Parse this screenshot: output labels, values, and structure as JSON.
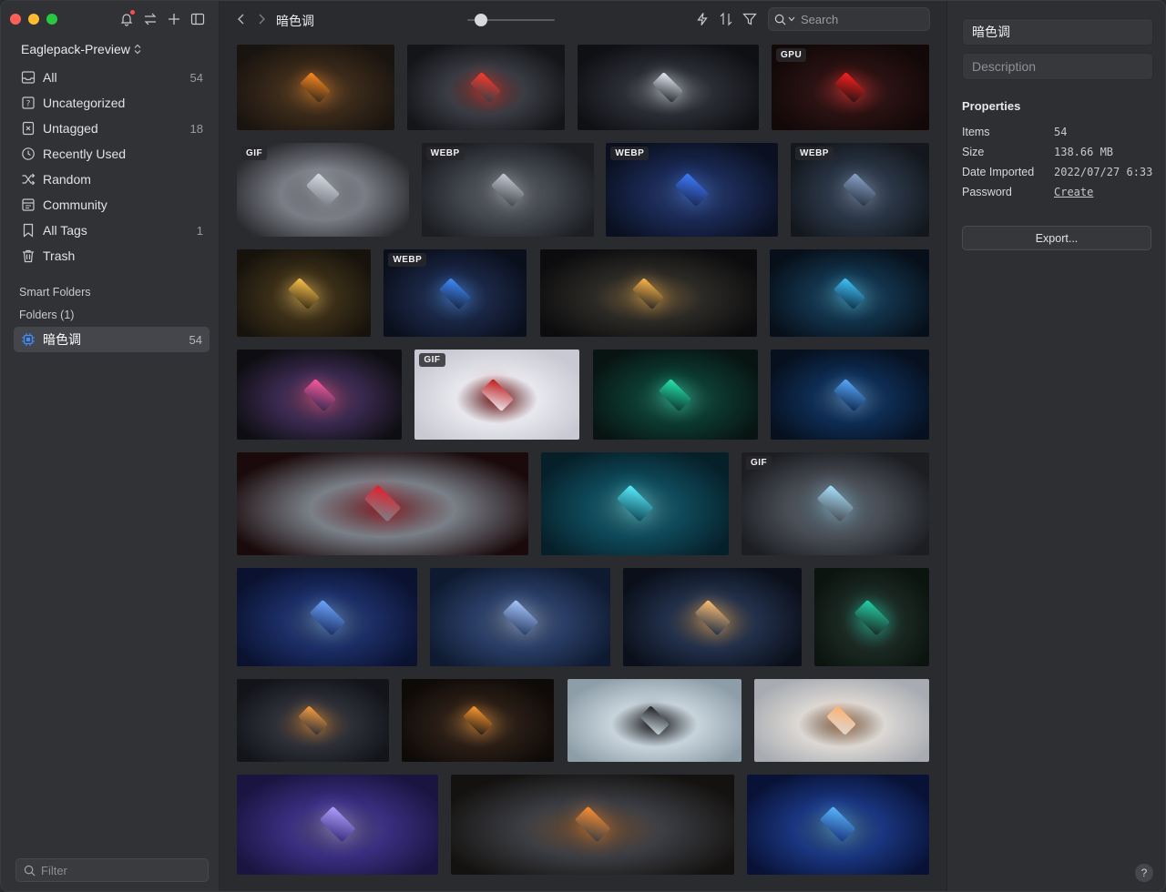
{
  "library": {
    "name": "Eaglepack-Preview"
  },
  "sidebar": {
    "items": [
      {
        "label": "All",
        "count": "54",
        "icon": "inbox-icon"
      },
      {
        "label": "Uncategorized",
        "count": "",
        "icon": "question-folder-icon"
      },
      {
        "label": "Untagged",
        "count": "18",
        "icon": "untagged-icon"
      },
      {
        "label": "Recently Used",
        "count": "",
        "icon": "clock-icon"
      },
      {
        "label": "Random",
        "count": "",
        "icon": "shuffle-icon"
      },
      {
        "label": "Community",
        "count": "",
        "icon": "community-icon"
      },
      {
        "label": "All Tags",
        "count": "1",
        "icon": "bookmark-icon"
      },
      {
        "label": "Trash",
        "count": "",
        "icon": "trash-icon"
      }
    ],
    "smart_folders_label": "Smart Folders",
    "folders_label": "Folders (1)",
    "folder": {
      "label": "暗色调",
      "count": "54"
    },
    "filter_placeholder": "Filter"
  },
  "toolbar": {
    "folder_title": "暗色调",
    "search_placeholder": "Search",
    "zoom_level": 0.1
  },
  "grid": {
    "rows": [
      [
        {
          "badge": ""
        },
        {
          "badge": ""
        },
        {
          "badge": ""
        },
        {
          "badge": "GPU"
        }
      ],
      [
        {
          "badge": "GIF"
        },
        {
          "badge": "WEBP"
        },
        {
          "badge": "WEBP"
        },
        {
          "badge": "WEBP"
        }
      ],
      [
        {
          "badge": ""
        },
        {
          "badge": "WEBP"
        },
        {
          "badge": ""
        },
        {
          "badge": ""
        }
      ],
      [
        {
          "badge": ""
        },
        {
          "badge": "GIF"
        },
        {
          "badge": ""
        },
        {
          "badge": ""
        }
      ],
      [
        {
          "badge": ""
        },
        {
          "badge": ""
        },
        {
          "badge": "GIF"
        }
      ],
      [
        {
          "badge": ""
        },
        {
          "badge": ""
        },
        {
          "badge": ""
        },
        {
          "badge": ""
        }
      ],
      [
        {
          "badge": ""
        },
        {
          "badge": ""
        },
        {
          "badge": ""
        },
        {
          "badge": ""
        }
      ],
      [
        {
          "badge": ""
        },
        {
          "badge": ""
        },
        {
          "badge": ""
        }
      ]
    ]
  },
  "inspector": {
    "name": "暗色调",
    "description_placeholder": "Description",
    "properties_title": "Properties",
    "properties": [
      {
        "key": "Items",
        "value": "54"
      },
      {
        "key": "Size",
        "value": "138.66 MB"
      },
      {
        "key": "Date Imported",
        "value": "2022/07/27 6:33"
      },
      {
        "key": "Password",
        "value": "Create"
      }
    ],
    "export_label": "Export...",
    "help_label": "?"
  },
  "colors": {
    "sidebar_bg": "#313236",
    "main_bg": "#2a2b2e",
    "selected_bg": "#45464b",
    "accent_blue": "#3f8cff"
  }
}
